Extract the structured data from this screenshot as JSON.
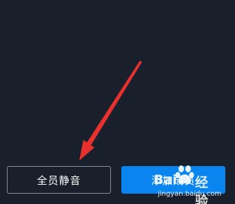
{
  "buttons": {
    "mute_all_label": "全员静音",
    "add_member_label": "添加成员"
  },
  "watermark": {
    "brand": "Bai",
    "suffix": "经验",
    "url": "jingyan.baidu.com"
  },
  "colors": {
    "background": "#19202b",
    "primary_button": "#0a84ee",
    "outline_button_border": "#8a9099",
    "annotation_arrow": "#e8312f"
  },
  "icons": {
    "annotation": "red-arrow-icon",
    "watermark_logo": "baidu-paw-icon"
  }
}
